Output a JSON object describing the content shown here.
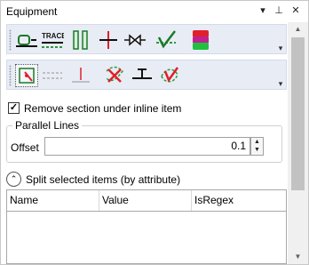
{
  "window": {
    "title": "Equipment",
    "buttons": {
      "menu": "▾",
      "pin": "⊥",
      "close": "✕"
    }
  },
  "toolbar1": {
    "overflow": "▾",
    "tools": [
      {
        "name": "insert-valve-icon"
      },
      {
        "name": "trace-line-icon",
        "text": "TRACE"
      },
      {
        "name": "parallel-pipes-icon"
      },
      {
        "name": "cross-section-icon"
      },
      {
        "name": "bowtie-valve-icon"
      },
      {
        "name": "check-path-icon"
      },
      {
        "name": "color-layers-icon"
      }
    ]
  },
  "toolbar2": {
    "overflow": "▾",
    "tools": [
      {
        "name": "select-element-icon"
      },
      {
        "name": "dashed-lines-icon"
      },
      {
        "name": "endpoint-tee-icon"
      },
      {
        "name": "delete-path-icon"
      },
      {
        "name": "tee-junction-icon"
      },
      {
        "name": "validate-path-icon"
      }
    ]
  },
  "checkbox": {
    "label": "Remove section under inline item",
    "checked": true,
    "mark": "✓"
  },
  "parallel": {
    "legend": "Parallel Lines",
    "offset_label": "Offset",
    "offset_value": "0.1",
    "up": "▲",
    "down": "▼"
  },
  "split": {
    "toggle": "⌃",
    "label": "Split selected items (by attribute)"
  },
  "grid": {
    "columns": [
      "Name",
      "Value",
      "IsRegex"
    ],
    "rows": []
  },
  "scrollbar": {
    "up": "▲",
    "down": "▼"
  },
  "colors": {
    "toolbar_bg": "#e8ecf4",
    "accent_red": "#e0202a",
    "accent_green": "#2a9a3a"
  }
}
